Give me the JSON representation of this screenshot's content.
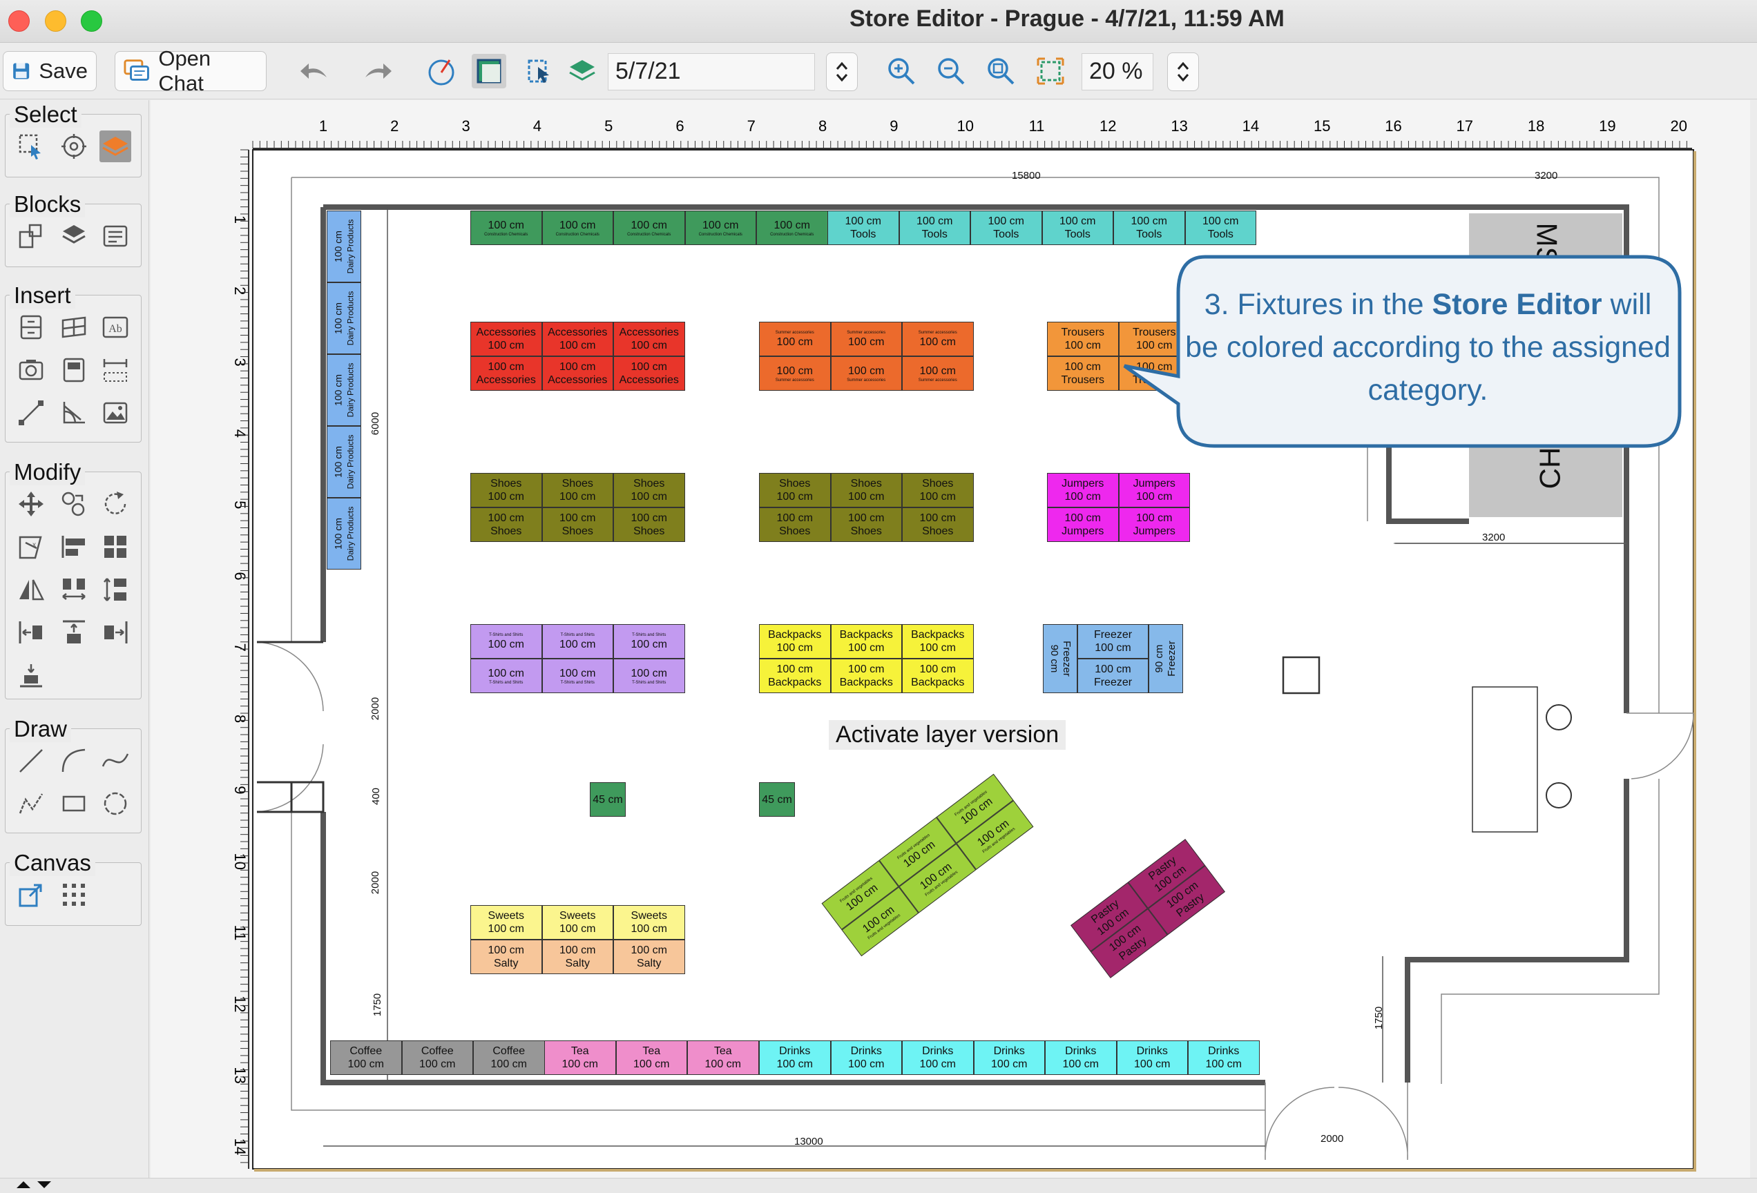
{
  "window": {
    "title": "Store Editor - Prague - 4/7/21, 11:59 AM"
  },
  "toolbar": {
    "save_label": "Save",
    "open_chat_label": "Open Chat",
    "date_value": "5/7/21",
    "zoom_value": "20 %"
  },
  "panel": {
    "select_title": "Select",
    "blocks_title": "Blocks",
    "insert_title": "Insert",
    "modify_title": "Modify",
    "draw_title": "Draw",
    "canvas_title": "Canvas"
  },
  "ruler": {
    "top": [
      "1",
      "2",
      "3",
      "4",
      "5",
      "6",
      "7",
      "8",
      "9",
      "10",
      "11",
      "12",
      "13",
      "14",
      "15",
      "16",
      "17",
      "18",
      "19",
      "20"
    ],
    "left": [
      "1",
      "2",
      "3",
      "4",
      "5",
      "6",
      "7",
      "8",
      "9",
      "10",
      "11",
      "12",
      "13",
      "14"
    ]
  },
  "dimensions": {
    "top_total": "15800",
    "top_right": "3200",
    "left_6000": "6000",
    "left_2000a": "2000",
    "left_400": "400",
    "left_2000b": "2000",
    "left_1750": "1750",
    "bottom_13000": "13000",
    "bottom_2000": "2000",
    "right_3200": "3200",
    "right_1750": "1750"
  },
  "callout": {
    "prefix": "3. Fixtures in the ",
    "bold": "Store Editor",
    "suffix": " will be colored according to the assigned category."
  },
  "overlay_label": "Activate layer version",
  "room_label": "CHA",
  "room_label2": "MS",
  "fixtures": {
    "size_100": "100 cm",
    "size_45": "45 cm",
    "size_90": "90 cm",
    "construction": "Construction Chemicals",
    "tools": "Tools",
    "dairy": "Dairy Products",
    "accessories": "Accessories",
    "summer": "Summer accessories",
    "trousers": "Trousers",
    "shoes": "Shoes",
    "jumpers": "Jumpers",
    "tshirts": "T-Shirts and Shirts",
    "backpacks": "Backpacks",
    "freezer": "Freezer",
    "sweets": "Sweets",
    "salty": "Salty",
    "fruits": "Fruits and vegetables",
    "pastry": "Pastry",
    "coffee": "Coffee",
    "tea": "Tea",
    "drinks": "Drinks"
  },
  "colors": {
    "construction": "#3f9a5c",
    "tools": "#5fd3cc",
    "dairy": "#7fb3ee",
    "accessories": "#e8352a",
    "summer": "#ec6a2c",
    "trousers": "#f2963a",
    "shoes": "#7f7f1d",
    "jumpers": "#ee28ee",
    "tshirts": "#c29af0",
    "backpacks": "#f6f23a",
    "freezer": "#86b9ea",
    "sweets": "#fbf58e",
    "salty": "#f7c69a",
    "fruits": "#9ed13b",
    "pastry": "#a3266b",
    "coffee": "#979797",
    "tea": "#ef8ecb",
    "drinks": "#6ef3f4",
    "callout_border": "#2e6da4"
  }
}
